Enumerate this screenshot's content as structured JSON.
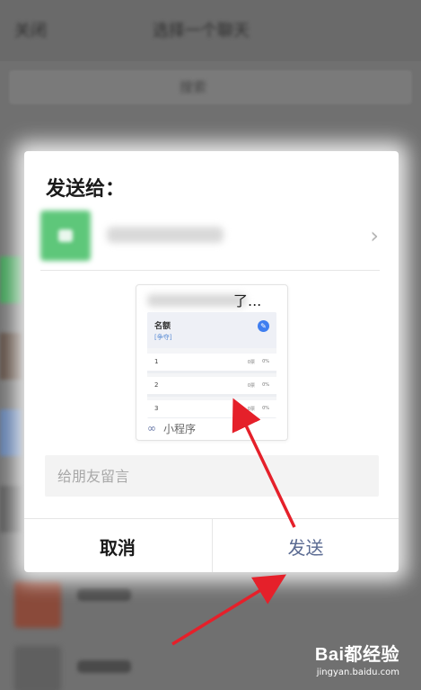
{
  "background": {
    "close_label": "关闭",
    "title": "选择一个聊天",
    "search_placeholder": "搜索",
    "colors": {
      "overlay": "#707070"
    }
  },
  "dialog": {
    "title": "发送给：",
    "recipient": {
      "avatar_color": "#5ec77a",
      "chevron_icon": "chevron-right-icon"
    },
    "card": {
      "title_suffix": "了...",
      "thumb": {
        "header_title": "名额",
        "header_sub": "[争夺]",
        "rows": [
          {
            "num": "1",
            "a": "0票",
            "b": "0%"
          },
          {
            "num": "2",
            "a": "0票",
            "b": "0%"
          },
          {
            "num": "3",
            "a": "0票",
            "b": "0%"
          }
        ]
      },
      "footer_icon": "mini-program-icon",
      "footer_label": "小程序"
    },
    "message_placeholder": "给朋友留言",
    "cancel_label": "取消",
    "send_label": "发送",
    "colors": {
      "send_text": "#5b6b92",
      "arrow": "#e5202a"
    }
  },
  "watermark": {
    "logo": "Bai都经验",
    "url": "jingyan.baidu.com"
  }
}
